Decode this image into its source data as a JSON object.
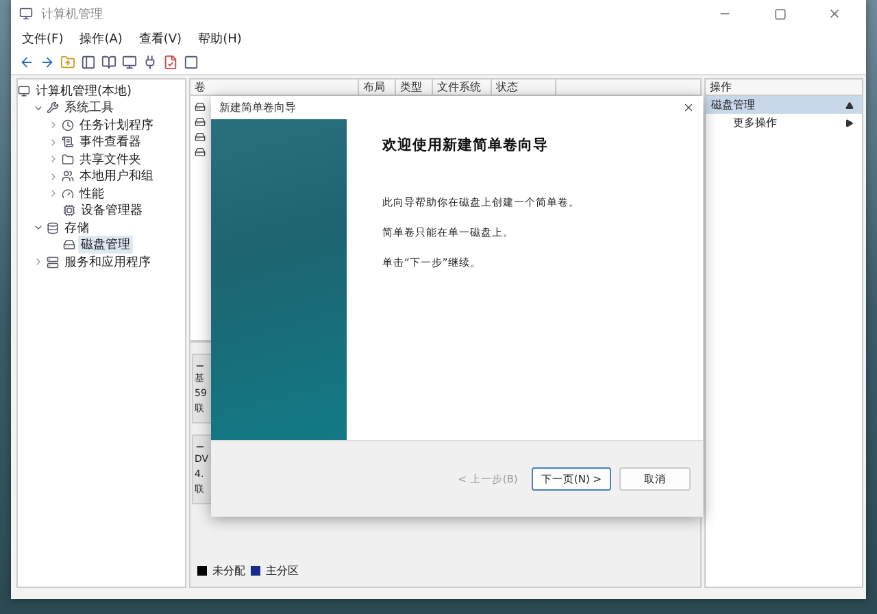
{
  "window": {
    "title": "计算机管理"
  },
  "menu": [
    {
      "label": "文件(F)"
    },
    {
      "label": "操作(A)"
    },
    {
      "label": "查看(V)"
    },
    {
      "label": "帮助(H)"
    }
  ],
  "tree": [
    {
      "label": "计算机管理(本地)",
      "kind": "computer",
      "selected": false,
      "children": [
        {
          "label": "系统工具",
          "kind": "tools",
          "expanded": true,
          "selected": false,
          "children": [
            {
              "label": "任务计划程序",
              "kind": "scheduler",
              "expanded": false,
              "selected": false
            },
            {
              "label": "事件查看器",
              "kind": "events",
              "expanded": false,
              "selected": false
            },
            {
              "label": "共享文件夹",
              "kind": "shares",
              "expanded": false,
              "selected": false
            },
            {
              "label": "本地用户和组",
              "kind": "accounts",
              "expanded": false,
              "selected": false
            },
            {
              "label": "性能",
              "kind": "performance",
              "expanded": false,
              "selected": false
            },
            {
              "label": "设备管理器",
              "kind": "devices",
              "selected": false
            }
          ]
        },
        {
          "label": "存储",
          "kind": "storage",
          "expanded": true,
          "selected": false,
          "children": [
            {
              "label": "磁盘管理",
              "kind": "disks",
              "selected": true
            }
          ]
        },
        {
          "label": "服务和应用程序",
          "kind": "services",
          "expanded": false,
          "selected": false
        }
      ]
    }
  ],
  "volumes": {
    "columns": [
      "卷",
      "布局",
      "类型",
      "文件系统",
      "状态"
    ]
  },
  "disks": [
    {
      "lines": [
        "基",
        "59",
        "联"
      ]
    },
    {
      "lines": [
        "DV",
        "4.",
        "联"
      ]
    }
  ],
  "legend": [
    {
      "label": "未分配",
      "color": "#000000"
    },
    {
      "label": "主分区",
      "color": "#1a2a8a"
    }
  ],
  "actions": {
    "header": "操作",
    "items": [
      {
        "label": "磁盘管理",
        "kind": "section",
        "selected": true
      },
      {
        "label": "更多操作",
        "kind": "submenu",
        "selected": false
      }
    ]
  },
  "dialog": {
    "title": "新建简单卷向导",
    "heading": "欢迎使用新建简单卷向导",
    "paragraphs": [
      "此向导帮助你在磁盘上创建一个简单卷。",
      "简单卷只能在单一磁盘上。",
      "单击“下一步”继续。"
    ],
    "buttons": [
      {
        "label": "< 上一步(B)",
        "disabled": true,
        "default": false
      },
      {
        "label": "下一页(N) >",
        "disabled": false,
        "default": true
      },
      {
        "label": "取消",
        "disabled": false,
        "default": false
      }
    ]
  }
}
